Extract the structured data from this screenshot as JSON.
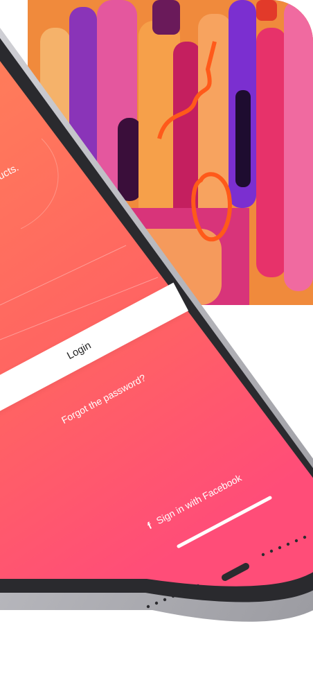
{
  "screen": {
    "partial_text": "ucts.",
    "login_label": "Login",
    "forgot_label": "Forgot the password?",
    "facebook_label": "Sign in with Facebook",
    "facebook_icon": "facebook-icon"
  },
  "colors": {
    "screen_top": "#ff7a5c",
    "screen_bottom": "#ff4f78",
    "frame": "#2a2a2e",
    "button_bg": "#ffffff"
  }
}
